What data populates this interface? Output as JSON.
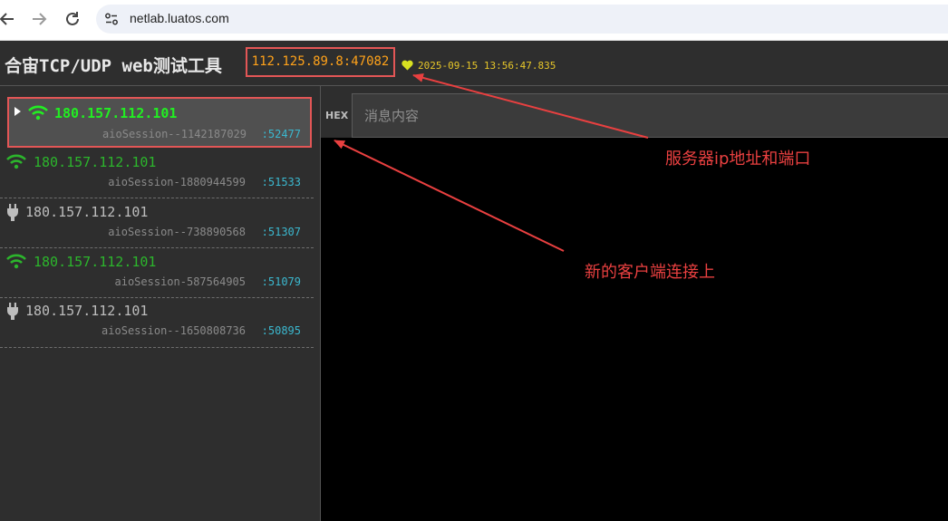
{
  "browser": {
    "url": "netlab.luatos.com"
  },
  "app": {
    "title": "合宙TCP/UDP web测试工具",
    "server_address": "112.125.89.8:47082",
    "server_time": "2025-09-15 13:56:47.835"
  },
  "clients": [
    {
      "ip": "180.157.112.101",
      "session": "aioSession--1142187029",
      "port": ":52477",
      "status_icon": "wifi-icon",
      "selected": true,
      "connected": true
    },
    {
      "ip": "180.157.112.101",
      "session": "aioSession-1880944599",
      "port": ":51533",
      "status_icon": "wifi-icon",
      "selected": false,
      "connected": true
    },
    {
      "ip": "180.157.112.101",
      "session": "aioSession--738890568",
      "port": ":51307",
      "status_icon": "plug-icon",
      "selected": false,
      "connected": false
    },
    {
      "ip": "180.157.112.101",
      "session": "aioSession-587564905",
      "port": ":51079",
      "status_icon": "wifi-icon",
      "selected": false,
      "connected": true
    },
    {
      "ip": "180.157.112.101",
      "session": "aioSession--1650808736",
      "port": ":50895",
      "status_icon": "plug-icon",
      "selected": false,
      "connected": false
    }
  ],
  "message": {
    "hex_label": "HEX",
    "placeholder": "消息内容"
  },
  "annotations": {
    "server": "服务器ip地址和端口",
    "new_client": "新的客户端连接上"
  },
  "colors": {
    "connected_selected": "#22ee22",
    "connected": "#2cb52c",
    "disconnected": "#bdbdbd",
    "server_address": "#ffa21a",
    "time": "#e6c629",
    "port": "#3bb8cf",
    "annotation": "#e94040"
  }
}
